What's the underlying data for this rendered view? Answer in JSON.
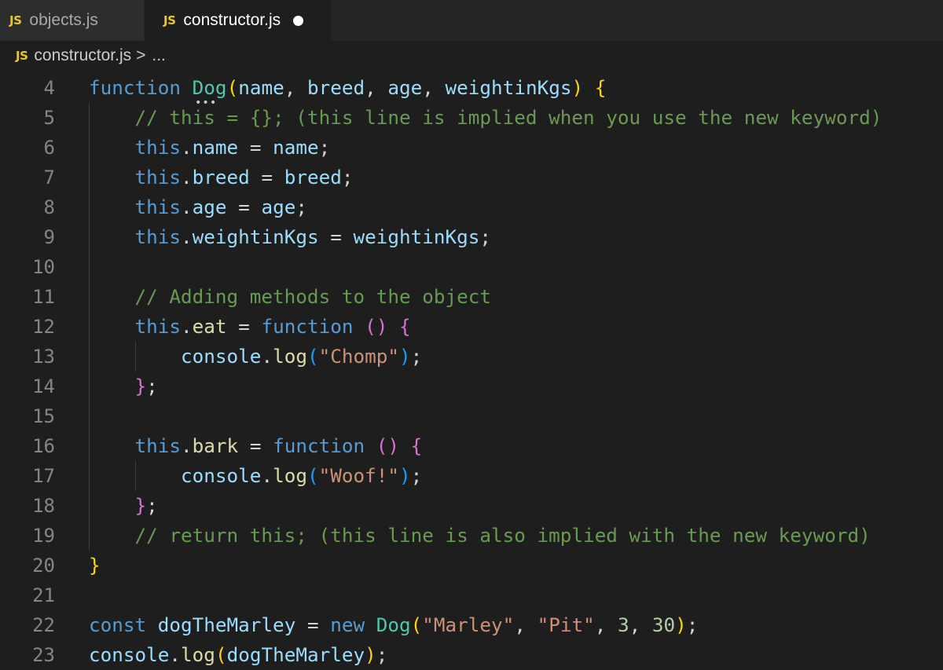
{
  "tabs": [
    {
      "badge": "JS",
      "label": "objects.js"
    },
    {
      "badge": "JS",
      "label": "constructor.js"
    }
  ],
  "breadcrumb": {
    "badge": "JS",
    "file": "constructor.js",
    "separator": ">",
    "rest": "..."
  },
  "editor": {
    "line_numbers": [
      "4",
      "5",
      "6",
      "7",
      "8",
      "9",
      "10",
      "11",
      "12",
      "13",
      "14",
      "15",
      "16",
      "17",
      "18",
      "19",
      "20",
      "21",
      "22",
      "23"
    ],
    "lines": [
      [
        [
          "kw",
          "function"
        ],
        [
          "pun",
          " "
        ],
        [
          "fn",
          "Dog"
        ],
        [
          "b1",
          "("
        ],
        [
          "param",
          "name"
        ],
        [
          "pun",
          ", "
        ],
        [
          "param",
          "breed"
        ],
        [
          "pun",
          ", "
        ],
        [
          "param",
          "age"
        ],
        [
          "pun",
          ", "
        ],
        [
          "param",
          "weightinKgs"
        ],
        [
          "b1",
          ")"
        ],
        [
          "pun",
          " "
        ],
        [
          "b1",
          "{"
        ]
      ],
      [
        [
          "pun",
          "    "
        ],
        [
          "com",
          "// this = {}; (this line is implied when you use the new keyword)"
        ]
      ],
      [
        [
          "pun",
          "    "
        ],
        [
          "kw",
          "this"
        ],
        [
          "pun",
          "."
        ],
        [
          "param",
          "name"
        ],
        [
          "pun",
          " = "
        ],
        [
          "param",
          "name"
        ],
        [
          "pun",
          ";"
        ]
      ],
      [
        [
          "pun",
          "    "
        ],
        [
          "kw",
          "this"
        ],
        [
          "pun",
          "."
        ],
        [
          "param",
          "breed"
        ],
        [
          "pun",
          " = "
        ],
        [
          "param",
          "breed"
        ],
        [
          "pun",
          ";"
        ]
      ],
      [
        [
          "pun",
          "    "
        ],
        [
          "kw",
          "this"
        ],
        [
          "pun",
          "."
        ],
        [
          "param",
          "age"
        ],
        [
          "pun",
          " = "
        ],
        [
          "param",
          "age"
        ],
        [
          "pun",
          ";"
        ]
      ],
      [
        [
          "pun",
          "    "
        ],
        [
          "kw",
          "this"
        ],
        [
          "pun",
          "."
        ],
        [
          "param",
          "weightinKgs"
        ],
        [
          "pun",
          " = "
        ],
        [
          "param",
          "weightinKgs"
        ],
        [
          "pun",
          ";"
        ]
      ],
      [],
      [
        [
          "pun",
          "    "
        ],
        [
          "com",
          "// Adding methods to the object"
        ]
      ],
      [
        [
          "pun",
          "    "
        ],
        [
          "kw",
          "this"
        ],
        [
          "pun",
          "."
        ],
        [
          "call",
          "eat"
        ],
        [
          "pun",
          " = "
        ],
        [
          "kw",
          "function"
        ],
        [
          "pun",
          " "
        ],
        [
          "b2",
          "()"
        ],
        [
          "pun",
          " "
        ],
        [
          "b2",
          "{"
        ]
      ],
      [
        [
          "pun",
          "        "
        ],
        [
          "param",
          "console"
        ],
        [
          "pun",
          "."
        ],
        [
          "call",
          "log"
        ],
        [
          "b3",
          "("
        ],
        [
          "str",
          "\"Chomp\""
        ],
        [
          "b3",
          ")"
        ],
        [
          "pun",
          ";"
        ]
      ],
      [
        [
          "pun",
          "    "
        ],
        [
          "b2",
          "}"
        ],
        [
          "pun",
          ";"
        ]
      ],
      [],
      [
        [
          "pun",
          "    "
        ],
        [
          "kw",
          "this"
        ],
        [
          "pun",
          "."
        ],
        [
          "call",
          "bark"
        ],
        [
          "pun",
          " = "
        ],
        [
          "kw",
          "function"
        ],
        [
          "pun",
          " "
        ],
        [
          "b2",
          "()"
        ],
        [
          "pun",
          " "
        ],
        [
          "b2",
          "{"
        ]
      ],
      [
        [
          "pun",
          "        "
        ],
        [
          "param",
          "console"
        ],
        [
          "pun",
          "."
        ],
        [
          "call",
          "log"
        ],
        [
          "b3",
          "("
        ],
        [
          "str",
          "\"Woof!\""
        ],
        [
          "b3",
          ")"
        ],
        [
          "pun",
          ";"
        ]
      ],
      [
        [
          "pun",
          "    "
        ],
        [
          "b2",
          "}"
        ],
        [
          "pun",
          ";"
        ]
      ],
      [
        [
          "pun",
          "    "
        ],
        [
          "com",
          "// return this; (this line is also implied with the new keyword)"
        ]
      ],
      [
        [
          "b1",
          "}"
        ]
      ],
      [],
      [
        [
          "kw",
          "const"
        ],
        [
          "pun",
          " "
        ],
        [
          "param",
          "dogTheMarley"
        ],
        [
          "pun",
          " = "
        ],
        [
          "kw",
          "new"
        ],
        [
          "pun",
          " "
        ],
        [
          "fn",
          "Dog"
        ],
        [
          "b1",
          "("
        ],
        [
          "str",
          "\"Marley\""
        ],
        [
          "pun",
          ", "
        ],
        [
          "str",
          "\"Pit\""
        ],
        [
          "pun",
          ", "
        ],
        [
          "num",
          "3"
        ],
        [
          "pun",
          ", "
        ],
        [
          "num",
          "30"
        ],
        [
          "b1",
          ")"
        ],
        [
          "pun",
          ";"
        ]
      ],
      [
        [
          "param",
          "console"
        ],
        [
          "pun",
          "."
        ],
        [
          "call",
          "log"
        ],
        [
          "b1",
          "("
        ],
        [
          "param",
          "dogTheMarley"
        ],
        [
          "b1",
          ")"
        ],
        [
          "pun",
          ";"
        ]
      ]
    ]
  }
}
